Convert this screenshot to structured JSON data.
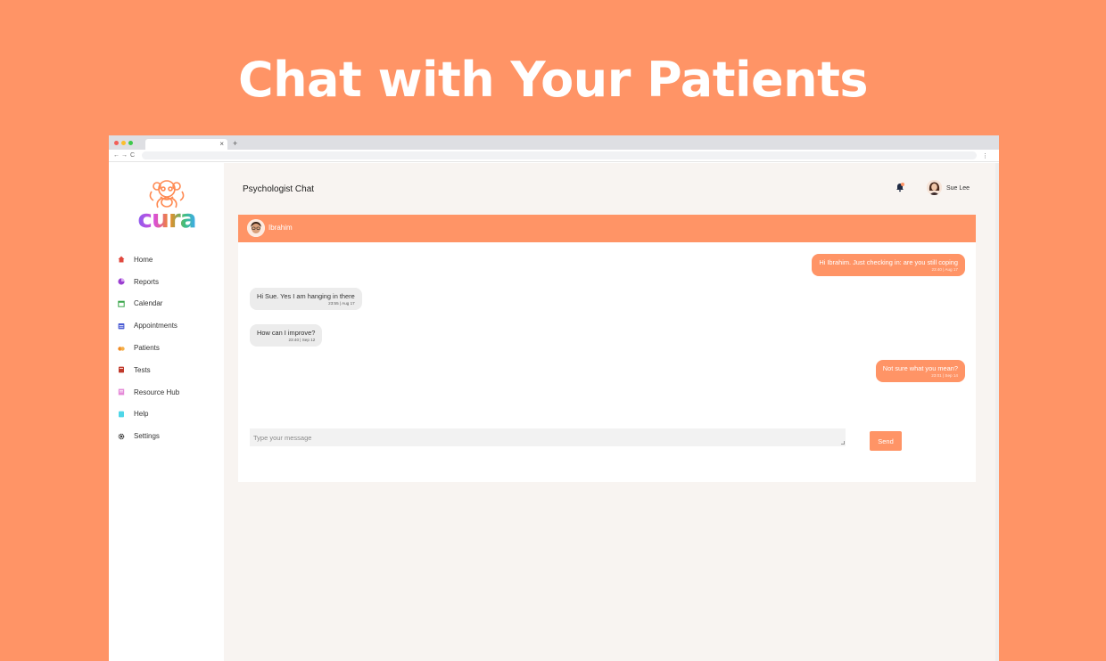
{
  "banner": {
    "title": "Chat with Your Patients"
  },
  "browser": {
    "tab_close": "×",
    "tab_new": "+",
    "nav_back": "←",
    "nav_forward": "→",
    "nav_reload": "C",
    "menu": "⋮"
  },
  "sidebar": {
    "logo_text": "cura",
    "items": [
      {
        "label": "Home",
        "icon": "home-icon",
        "color": "#e0483e"
      },
      {
        "label": "Reports",
        "icon": "reports-icon",
        "color": "#9b3fd0"
      },
      {
        "label": "Calendar",
        "icon": "calendar-icon",
        "color": "#3aa64a"
      },
      {
        "label": "Appointments",
        "icon": "appointments-icon",
        "color": "#4a5bd4"
      },
      {
        "label": "Patients",
        "icon": "patients-icon",
        "color": "#f08a24"
      },
      {
        "label": "Tests",
        "icon": "tests-icon",
        "color": "#c0392b"
      },
      {
        "label": "Resource Hub",
        "icon": "resource-hub-icon",
        "color": "#e58ad8"
      },
      {
        "label": "Help",
        "icon": "help-icon",
        "color": "#4fd6e8"
      },
      {
        "label": "Settings",
        "icon": "gear-icon",
        "color": "#333333"
      }
    ]
  },
  "header": {
    "title": "Psychologist Chat",
    "user_name": "Sue Lee"
  },
  "chat": {
    "contact_name": "Ibrahim",
    "messages": [
      {
        "direction": "out",
        "text": "Hi Ibrahim. Just checking in: are you still coping",
        "time": "23:40 | Aug 17"
      },
      {
        "direction": "in",
        "text": "Hi Sue. Yes I am hanging in there",
        "time": "23:55 | Aug 17"
      },
      {
        "direction": "in",
        "text": "How can I improve?",
        "time": "23:40 | Sep 12"
      },
      {
        "direction": "out",
        "text": "Not sure what you mean?",
        "time": "23:01 | Sep 14"
      }
    ],
    "input_placeholder": "Type your message",
    "send_label": "Send"
  },
  "colors": {
    "accent": "#ff9466",
    "background": "#f8f4f1"
  }
}
